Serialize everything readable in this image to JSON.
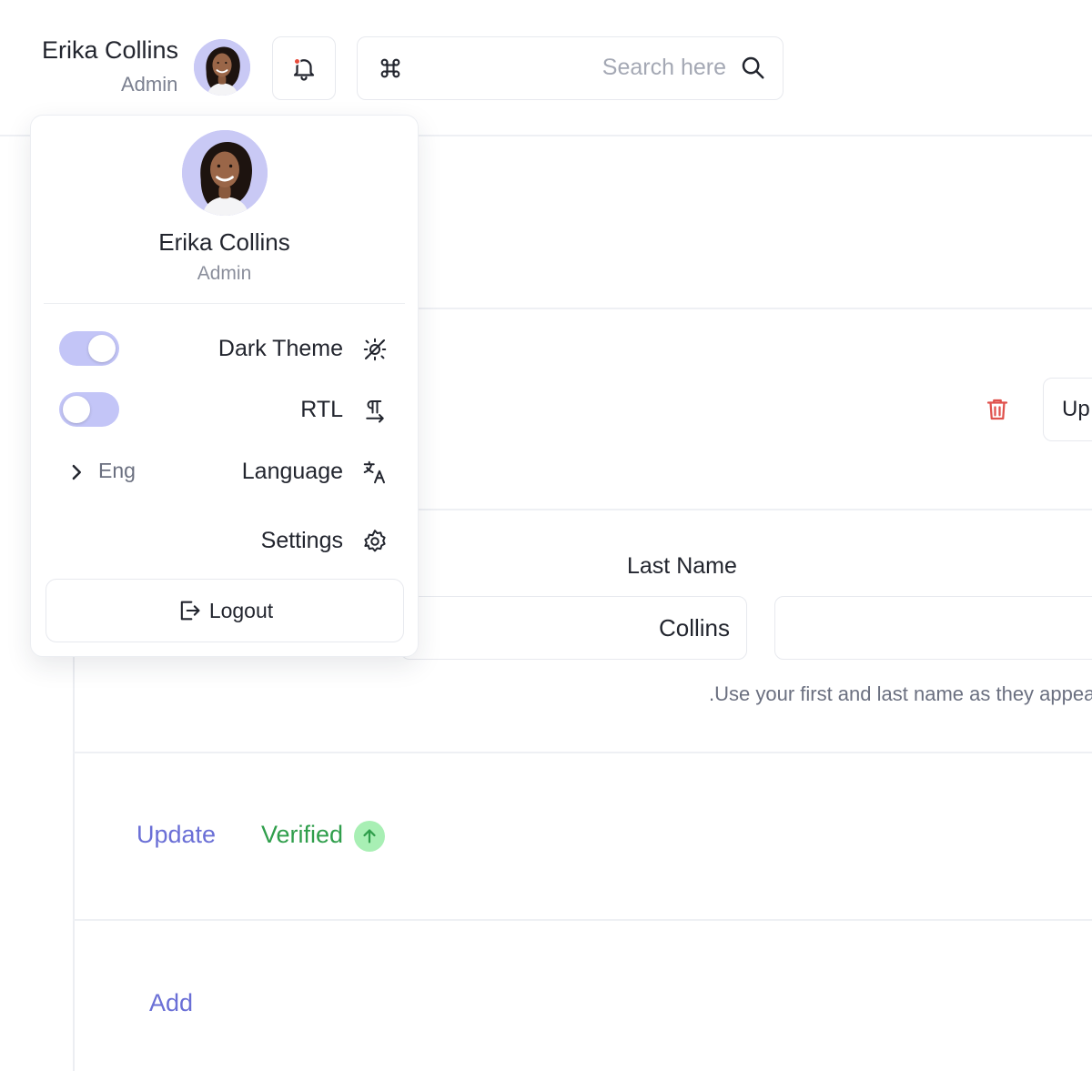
{
  "header": {
    "user_name": "Erika Collins",
    "user_role": "Admin",
    "search_placeholder": "Search here"
  },
  "menu": {
    "user_name": "Erika Collins",
    "user_role": "Admin",
    "items": [
      {
        "label": "Dark Theme",
        "icon": "dark-theme-icon",
        "toggle": true,
        "enabled": true
      },
      {
        "label": "RTL",
        "icon": "rtl-icon",
        "toggle": true,
        "enabled": false
      },
      {
        "label": "Language",
        "icon": "translate-icon",
        "value": "Eng"
      },
      {
        "label": "Settings",
        "icon": "gear-icon"
      }
    ],
    "logout_label": "Logout"
  },
  "page": {
    "up_button_label": "Up",
    "last_name_label": "Last Name",
    "last_name_value": "Collins",
    "name_hint": ".Use your first and last name as they appear",
    "update_label": "Update",
    "verified_label": "Verified",
    "add_label": "Add"
  },
  "colors": {
    "accent": "#6a6fd6",
    "toggle_track": "#c3c5f7",
    "verified_green": "#2f9e4b",
    "verified_bg": "#a8efb4",
    "danger": "#e0524d",
    "notification_dot": "#e74c3c"
  }
}
